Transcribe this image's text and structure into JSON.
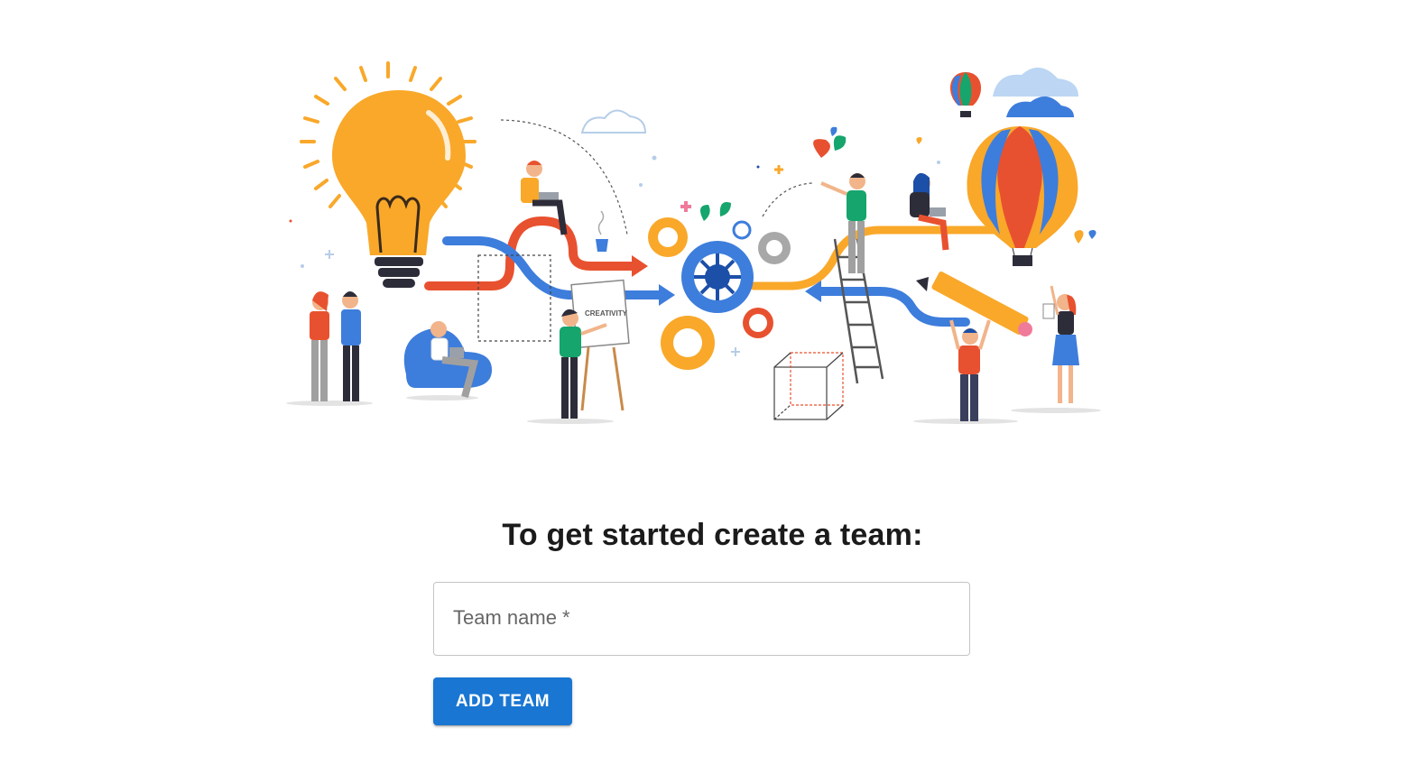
{
  "hero": {
    "illustration": "team-creativity-illustration",
    "board_text": "CREATIVITY"
  },
  "main": {
    "heading": "To get started create a team:",
    "team_name_field": {
      "label": "Team name *",
      "value": ""
    },
    "add_button_label": "ADD TEAM"
  },
  "colors": {
    "primary": "#1976d2",
    "orange": "#f9a82a",
    "red": "#e8512f",
    "blue": "#3d7ddc",
    "green": "#16a56c"
  }
}
